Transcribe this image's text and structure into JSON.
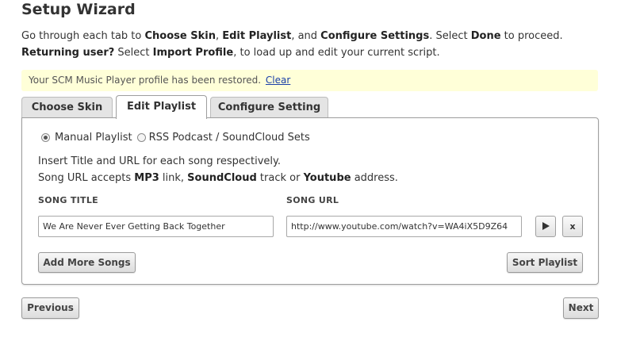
{
  "page": {
    "title": "Setup Wizard",
    "intro": {
      "l1_a": "Go through each tab to ",
      "l1_b": "Choose Skin",
      "l1_c": ", ",
      "l1_d": "Edit Playlist",
      "l1_e": ", and ",
      "l1_f": "Configure Settings",
      "l1_g": ". Select ",
      "l1_h": "Done",
      "l1_i": " to proceed.",
      "l2_a": "Returning user?",
      "l2_b": " Select ",
      "l2_c": "Import Profile",
      "l2_d": ", to load up and edit your current script."
    }
  },
  "notice": {
    "text": "Your SCM Music Player profile has been restored.",
    "link": "Clear",
    "bg_color": "#ffffd8"
  },
  "tabs": [
    {
      "label": "Choose Skin",
      "active": false
    },
    {
      "label": "Edit Playlist",
      "active": true
    },
    {
      "label": "Configure Setting",
      "active": false
    }
  ],
  "playlist": {
    "radio_manual": "Manual Playlist",
    "radio_rss": "RSS Podcast / SoundCloud Sets",
    "selected": "manual",
    "help": {
      "l1": "Insert Title and URL for each song respectively.",
      "l2_a": "Song URL accepts ",
      "l2_b": "MP3",
      "l2_c": " link, ",
      "l2_d": "SoundCloud",
      "l2_e": " track or ",
      "l2_f": "Youtube",
      "l2_g": " address."
    },
    "col_title": "SONG TITLE",
    "col_url": "SONG URL",
    "songs": [
      {
        "title": "We Are Never Ever Getting Back Together",
        "url": "http://www.youtube.com/watch?v=WA4iX5D9Z64"
      }
    ],
    "play_icon": "play-icon",
    "remove_label": "x",
    "add_label": "Add More Songs",
    "sort_label": "Sort Playlist"
  },
  "nav": {
    "previous": "Previous",
    "next": "Next"
  }
}
